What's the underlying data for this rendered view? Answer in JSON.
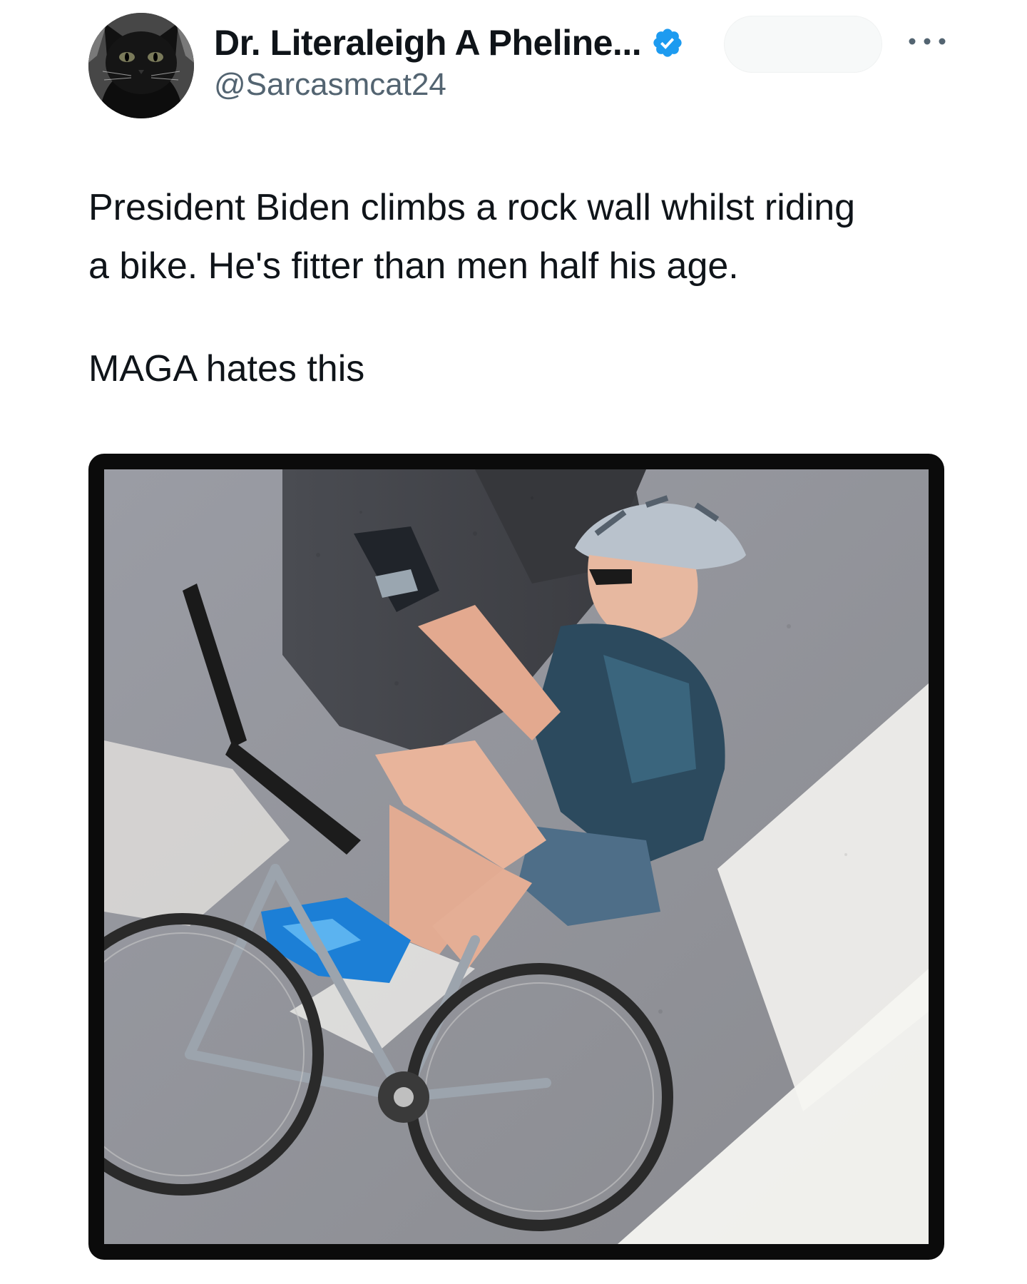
{
  "tweet": {
    "author": {
      "display_name": "Dr. Literaleigh A Pheline...",
      "handle": "@Sarcasmcat24",
      "verified": true,
      "avatar_icon": "black-cat-avatar"
    },
    "text_paragraphs": [
      "President Biden climbs a rock wall whilst riding\na bike. He's fitter than men half his age.",
      "MAGA hates this"
    ],
    "media": {
      "type": "photo",
      "description_icon": "cyclist-photo"
    },
    "more_icon": "more-options-icon"
  },
  "colors": {
    "text_primary": "#0f1419",
    "text_secondary": "#536471",
    "verified_blue": "#1d9bf0",
    "media_border": "#0b0b0b"
  }
}
